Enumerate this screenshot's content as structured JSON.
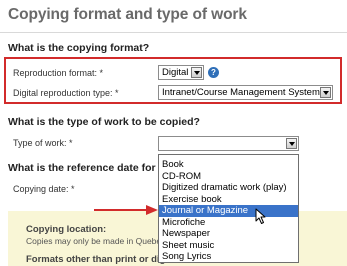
{
  "page": {
    "title": "Copying format and type of work"
  },
  "format_section": {
    "question": "What is the copying format?",
    "reproduction_format": {
      "label": "Reproduction format: *",
      "value": "Digital"
    },
    "digital_type": {
      "label": "Digital reproduction type: *",
      "value": "Intranet/Course Management System"
    }
  },
  "work_section": {
    "question": "What is the type of work to be copied?",
    "type_label": "Type of work: *",
    "type_value": "",
    "options": [
      "Book",
      "CD-ROM",
      "Digitized dramatic work (play)",
      "Exercise book",
      "Journal or Magazine",
      "Microfiche",
      "Newspaper",
      "Sheet music",
      "Song Lyrics"
    ],
    "highlighted_option": "Journal or Magazine"
  },
  "reference_section": {
    "question": "What is the reference date for the",
    "date_label": "Copying date: *"
  },
  "location_panel": {
    "heading": "Copying location:",
    "note": "Copies may only be made in Quebec",
    "formats_heading": "Formats other than print or digi"
  },
  "help_icon": {
    "glyph": "?"
  },
  "colors": {
    "highlight": "#d22b2b",
    "selection": "#3a73c9",
    "panel_bg": "#f9f6d6"
  }
}
